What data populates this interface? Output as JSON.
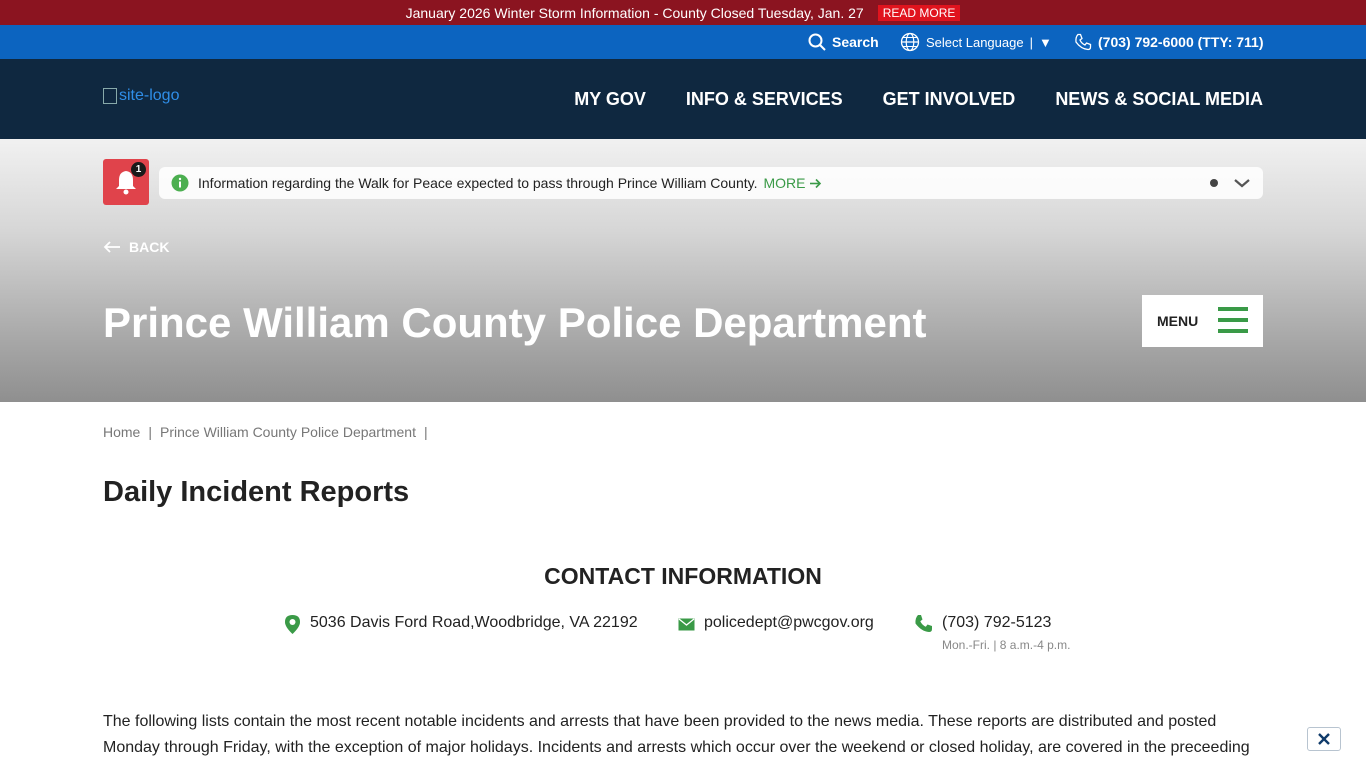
{
  "alert_bar": {
    "message": "January 2026 Winter Storm Information - County Closed Tuesday, Jan. 27",
    "read_more": "READ MORE"
  },
  "utility": {
    "search_label": "Search",
    "language_label": "Select Language",
    "language_caret": "▼",
    "divider": "|",
    "phone": "(703) 792-6000 (TTY: 711)"
  },
  "header": {
    "logo_alt": "site-logo",
    "nav": [
      "MY GOV",
      "INFO & SERVICES",
      "GET INVOLVED",
      "NEWS & SOCIAL MEDIA"
    ]
  },
  "hero": {
    "notification_count": "1",
    "notice_text": "Information regarding the Walk for Peace expected to pass through Prince William County.",
    "notice_more": "MORE",
    "back_label": "BACK",
    "title": "Prince William County Police Department",
    "menu_label": "MENU"
  },
  "breadcrumb": {
    "items": [
      "Home",
      "Prince William County Police Department"
    ],
    "separator": "|"
  },
  "page": {
    "title": "Daily Incident Reports"
  },
  "contact": {
    "heading": "CONTACT INFORMATION",
    "address": "5036 Davis Ford Road,Woodbridge, VA 22192",
    "email": "policedept@pwcgov.org",
    "phone": "(703) 792-5123",
    "hours": "Mon.-Fri. | 8 a.m.-4 p.m."
  },
  "intro": {
    "text": "The following lists contain the most recent notable incidents and arrests that have been provided to the news media. These reports are distributed and posted Monday through Friday, with the exception of major holidays. Incidents and arrests which occur over the weekend or closed holiday, are covered in the preceeding"
  },
  "colors": {
    "alert_bar": "#8b1420",
    "read_more": "#e0141e",
    "utility_bar": "#0c64c0",
    "header": "#0f2840",
    "accent_green": "#3a9a47",
    "bell": "#e0434b"
  }
}
